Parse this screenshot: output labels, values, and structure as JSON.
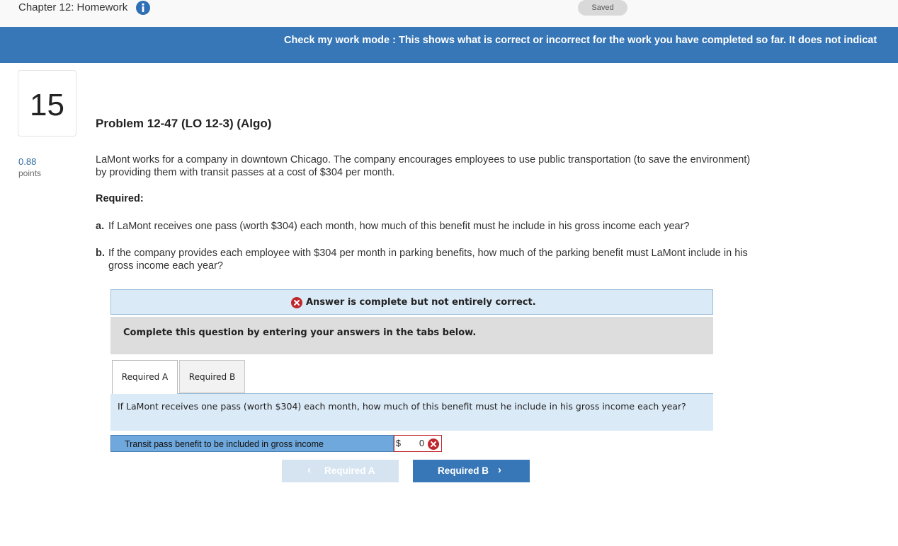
{
  "header": {
    "chapter_title": "Chapter 12: Homework",
    "saved_label": "Saved"
  },
  "banner": {
    "text": "Check my work mode : This shows what is correct or incorrect for the work you have completed so far. It does not indicat"
  },
  "question": {
    "number": "15",
    "points_value": "0.88",
    "points_label": "points",
    "title": "Problem 12-47 (LO 12-3) (Algo)",
    "intro": "LaMont works for a company in downtown Chicago. The company encourages employees to use public transportation (to save the environment) by providing them with transit passes at a cost of $304 per month.",
    "required_header": "Required:",
    "part_a_letter": "a.",
    "part_a_text": "If LaMont receives one pass (worth $304) each month, how much of this benefit must he include in his gross income each year?",
    "part_b_letter": "b.",
    "part_b_text": "If the company provides each employee with $304 per month in parking benefits, how much of the parking benefit must LaMont include in his gross income each year?"
  },
  "answer_status": {
    "text": "Answer is complete but not entirely correct."
  },
  "instructions": {
    "text": "Complete this question by entering your answers in the tabs below."
  },
  "tabs": [
    {
      "label": "Required A",
      "active": true
    },
    {
      "label": "Required B",
      "active": false
    }
  ],
  "tab_content": {
    "question": "If LaMont receives one pass (worth $304) each month, how much of this benefit must he include in his gross income each year?",
    "row_label": "Transit pass benefit to be included in gross income",
    "currency": "$",
    "value": "0",
    "status": "incorrect"
  },
  "navigation": {
    "prev_label": "Required A",
    "next_label": "Required B",
    "prev_chevron": "‹",
    "next_chevron": "›"
  },
  "colors": {
    "banner": "#3777b8",
    "incorrect": "#c0282d",
    "answer_label_bg": "#6fa8dc",
    "status_bg": "#dbeaf7"
  },
  "icons": {
    "info": "info-icon",
    "incorrect": "x-circle-icon",
    "prev": "chevron-left-icon",
    "next": "chevron-right-icon"
  }
}
